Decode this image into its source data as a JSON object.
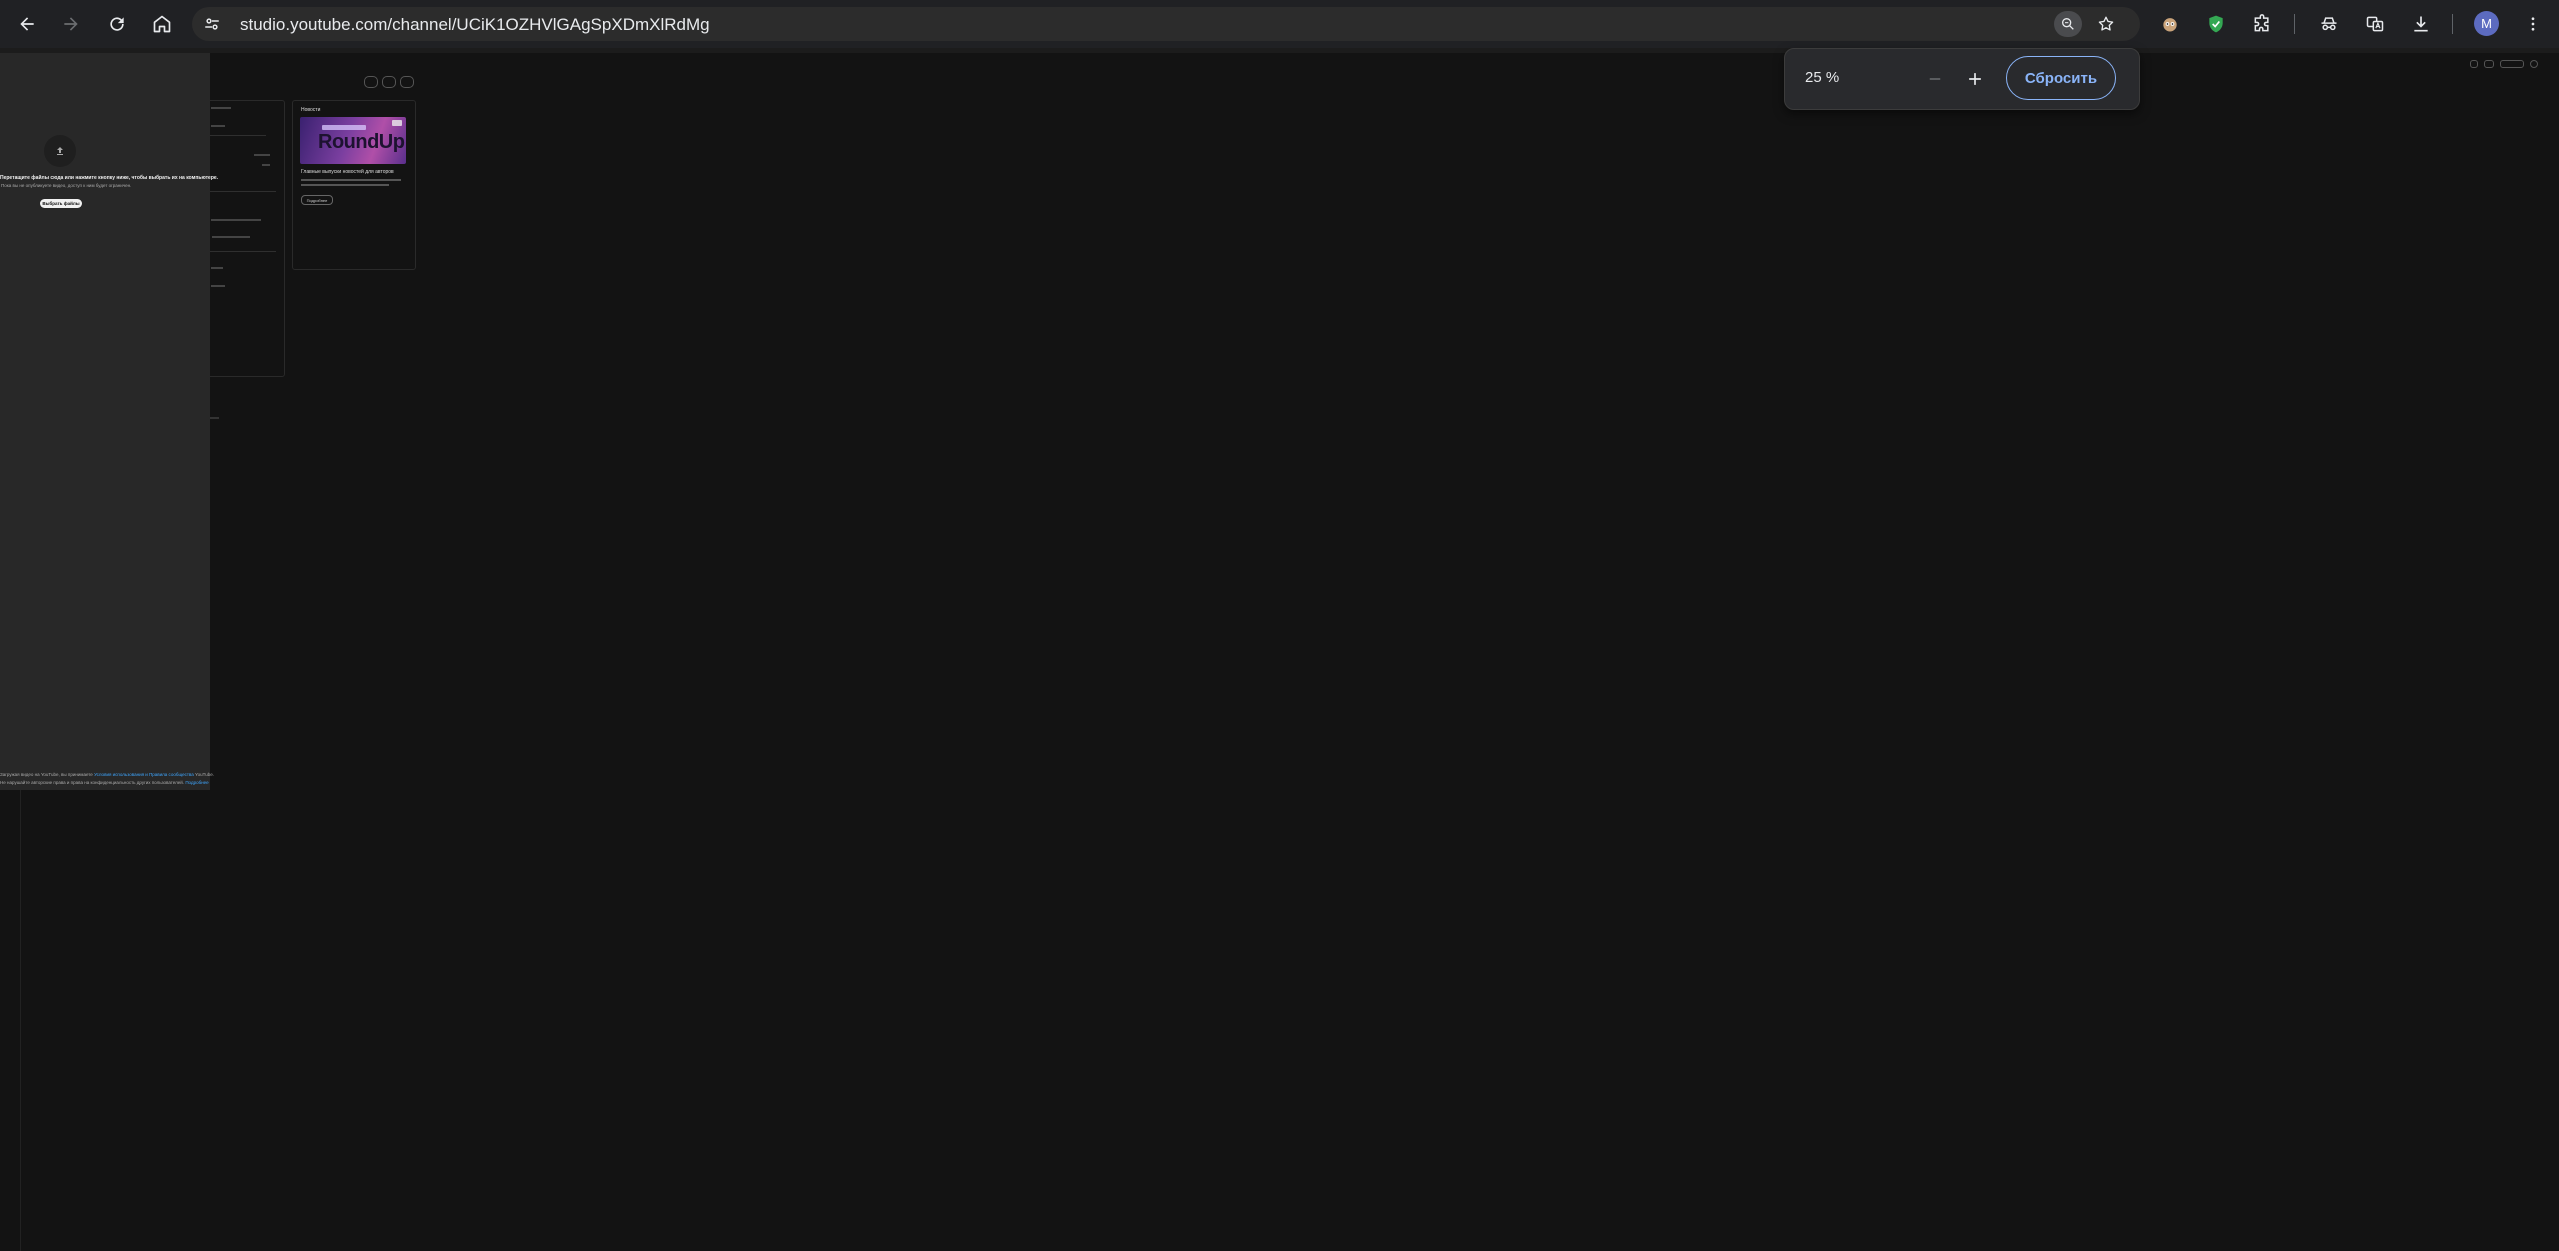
{
  "browser": {
    "url": "studio.youtube.com/channel/UCiK1OZHVlGAgSpXDmXlRdMg",
    "avatar_letter": "M",
    "nav_icons": [
      "back-icon",
      "forward-icon",
      "reload-icon",
      "home-icon"
    ],
    "extension_icons": [
      "monkey-extension-icon",
      "shield-extension-icon",
      "puzzle-extensions-icon",
      "incognito-spy-icon",
      "translate-icon",
      "download-icon"
    ]
  },
  "zoom_popup": {
    "value": "25 %",
    "reset_label": "Сбросить"
  },
  "colors": {
    "accent": "#8ab4f8",
    "avatar_bg": "#5c6bc0",
    "page_bg": "#131313",
    "toolbar_bg": "#202124"
  },
  "studio": {
    "news_card": {
      "title": "Новости",
      "thumbnail_text": "RoundUp",
      "headline": "Главные выпуски новостей для авторов",
      "share_button": "Подробнее"
    },
    "upload_dialog": {
      "title": "Перетащите файлы сюда или нажмите кнопку ниже, чтобы выбрать их на компьютере.",
      "subtitle": "Пока вы не опубликуете видео, доступ к ним будет ограничен.",
      "select_button": "Выбрать файлы",
      "terms_line1_prefix": "Загружая видео на YouTube, вы принимаете ",
      "terms_line1_link": "Условия использования и Правила сообщества",
      "terms_line1_suffix": " YouTube.",
      "terms_line2_prefix": "Не нарушайте авторские права и права на конфиденциальность других пользователей. ",
      "terms_line2_link": "Подробнее"
    }
  }
}
